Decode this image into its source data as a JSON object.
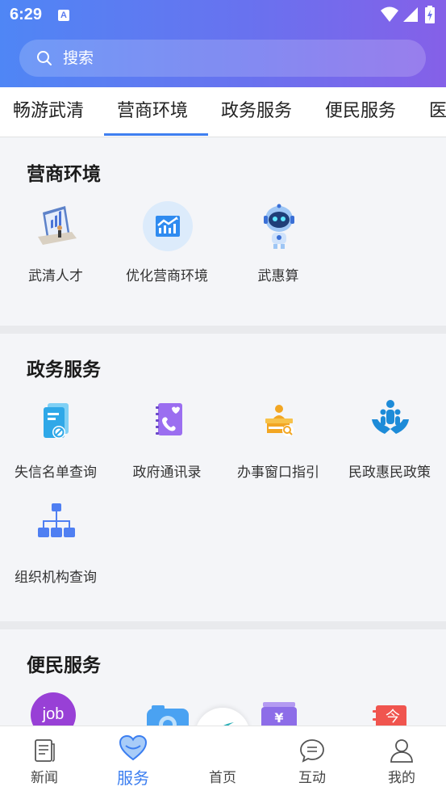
{
  "status": {
    "time": "6:29",
    "app_badge": "A"
  },
  "search": {
    "placeholder": "搜索"
  },
  "tabs": [
    {
      "label": "畅游武清"
    },
    {
      "label": "营商环境"
    },
    {
      "label": "政务服务"
    },
    {
      "label": "便民服务"
    },
    {
      "label": "医"
    }
  ],
  "active_tab": "营商环境",
  "sections": {
    "business": {
      "title": "营商环境",
      "items": [
        {
          "label": "武清人才",
          "icon": "talent-presentation-icon"
        },
        {
          "label": "优化营商环境",
          "icon": "chart-trend-icon"
        },
        {
          "label": "武惠算",
          "icon": "robot-icon"
        }
      ]
    },
    "government": {
      "title": "政务服务",
      "items": [
        {
          "label": "失信名单查询",
          "icon": "blacklist-document-icon"
        },
        {
          "label": "政府通讯录",
          "icon": "phone-book-icon"
        },
        {
          "label": "办事窗口指引",
          "icon": "service-window-icon"
        },
        {
          "label": "民政惠民政策",
          "icon": "people-care-icon"
        },
        {
          "label": "组织机构查询",
          "icon": "org-chart-icon"
        }
      ]
    },
    "convenience": {
      "title": "便民服务",
      "items": [
        {
          "label": "",
          "icon": "job-icon",
          "badge": "job"
        },
        {
          "label": "",
          "icon": "camera-icon"
        },
        {
          "label": "",
          "icon": "wallet-yuan-icon",
          "badge": "¥"
        },
        {
          "label": "",
          "icon": "today-calendar-icon",
          "badge": "今"
        }
      ]
    }
  },
  "bottom_nav": [
    {
      "label": "新闻",
      "icon": "news-icon"
    },
    {
      "label": "服务",
      "icon": "heart-icon",
      "active": true
    },
    {
      "label": "首页",
      "icon": "home-logo-icon"
    },
    {
      "label": "互动",
      "icon": "chat-icon"
    },
    {
      "label": "我的",
      "icon": "user-icon"
    }
  ],
  "colors": {
    "accent": "#3b7ef0",
    "header_start": "#4f86f5",
    "header_end": "#8560e8"
  }
}
